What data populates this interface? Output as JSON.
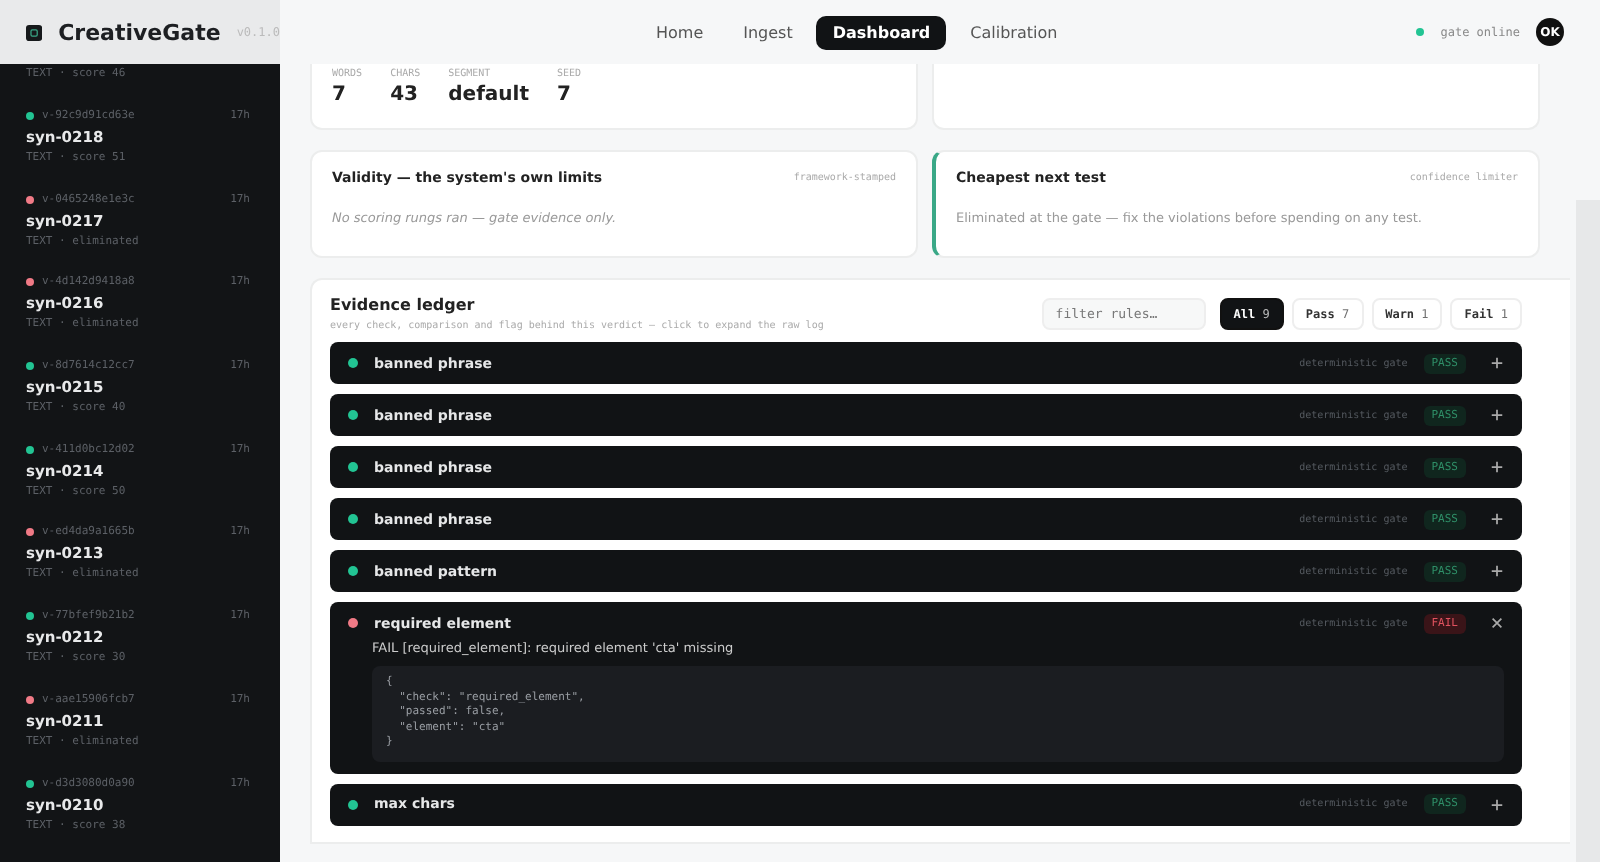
{
  "brand": {
    "name": "CreativeGate",
    "version": "v0.1.0"
  },
  "nav": [
    {
      "label": "Home",
      "selected": false
    },
    {
      "label": "Ingest",
      "selected": false
    },
    {
      "label": "Dashboard",
      "selected": true
    },
    {
      "label": "Calibration",
      "selected": false
    }
  ],
  "status": {
    "label": "gate online",
    "avatar": "OK"
  },
  "sidebar": {
    "partial_meta": "TEXT · score 46",
    "items": [
      {
        "hash": "v-92c9d91cd63e",
        "age": "17h",
        "name": "syn-0218",
        "meta": "TEXT · score 51",
        "color": "#22c493"
      },
      {
        "hash": "v-0465248e1e3c",
        "age": "17h",
        "name": "syn-0217",
        "meta": "TEXT · eliminated",
        "color": "#f07a86"
      },
      {
        "hash": "v-4d142d9418a8",
        "age": "17h",
        "name": "syn-0216",
        "meta": "TEXT · eliminated",
        "color": "#f07a86"
      },
      {
        "hash": "v-8d7614c12cc7",
        "age": "17h",
        "name": "syn-0215",
        "meta": "TEXT · score 40",
        "color": "#22c493"
      },
      {
        "hash": "v-411d0bc12d02",
        "age": "17h",
        "name": "syn-0214",
        "meta": "TEXT · score 50",
        "color": "#22c493"
      },
      {
        "hash": "v-ed4da9a1665b",
        "age": "17h",
        "name": "syn-0213",
        "meta": "TEXT · eliminated",
        "color": "#f07a86"
      },
      {
        "hash": "v-77bfef9b21b2",
        "age": "17h",
        "name": "syn-0212",
        "meta": "TEXT · score 30",
        "color": "#22c493"
      },
      {
        "hash": "v-aae15906fcb7",
        "age": "17h",
        "name": "syn-0211",
        "meta": "TEXT · eliminated",
        "color": "#f07a86"
      },
      {
        "hash": "v-d3d3080d0a90",
        "age": "17h",
        "name": "syn-0210",
        "meta": "TEXT · score 38",
        "color": "#22c493"
      }
    ]
  },
  "stats": [
    {
      "label": "WORDS",
      "value": "7"
    },
    {
      "label": "CHARS",
      "value": "43"
    },
    {
      "label": "SEGMENT",
      "value": "default"
    },
    {
      "label": "SEED",
      "value": "7"
    }
  ],
  "validity": {
    "title": "Validity — the system's own limits",
    "tag": "framework-stamped",
    "text": "No scoring rungs ran — gate evidence only."
  },
  "next_test": {
    "title": "Cheapest next test",
    "tag": "confidence limiter",
    "text": "Eliminated at the gate — fix the violations before spending on any test."
  },
  "ledger": {
    "title": "Evidence ledger",
    "subtitle": "every check, comparison and flag behind this verdict — click to expand the raw log",
    "filter_placeholder": "filter rules…",
    "filters": [
      {
        "label": "All",
        "count": "9",
        "selected": true
      },
      {
        "label": "Pass",
        "count": "7",
        "selected": false
      },
      {
        "label": "Warn",
        "count": "1",
        "selected": false
      },
      {
        "label": "Fail",
        "count": "1",
        "selected": false
      }
    ],
    "rows": [
      {
        "name": "banned phrase",
        "source": "deterministic gate",
        "result": "PASS",
        "kind": "pass",
        "expanded": false
      },
      {
        "name": "banned phrase",
        "source": "deterministic gate",
        "result": "PASS",
        "kind": "pass",
        "expanded": false
      },
      {
        "name": "banned phrase",
        "source": "deterministic gate",
        "result": "PASS",
        "kind": "pass",
        "expanded": false
      },
      {
        "name": "banned phrase",
        "source": "deterministic gate",
        "result": "PASS",
        "kind": "pass",
        "expanded": false
      },
      {
        "name": "banned pattern",
        "source": "deterministic gate",
        "result": "PASS",
        "kind": "pass",
        "expanded": false
      },
      {
        "name": "required element",
        "source": "deterministic gate",
        "result": "FAIL",
        "kind": "fail",
        "expanded": true,
        "detail": "FAIL [required_element]: required element 'cta' missing",
        "log": [
          "{",
          "  \"check\": \"required_element\",",
          "  \"passed\": false,",
          "  \"element\": \"cta\"",
          "}"
        ]
      },
      {
        "name": "max chars",
        "source": "deterministic gate",
        "result": "PASS",
        "kind": "pass",
        "expanded": false
      }
    ]
  }
}
